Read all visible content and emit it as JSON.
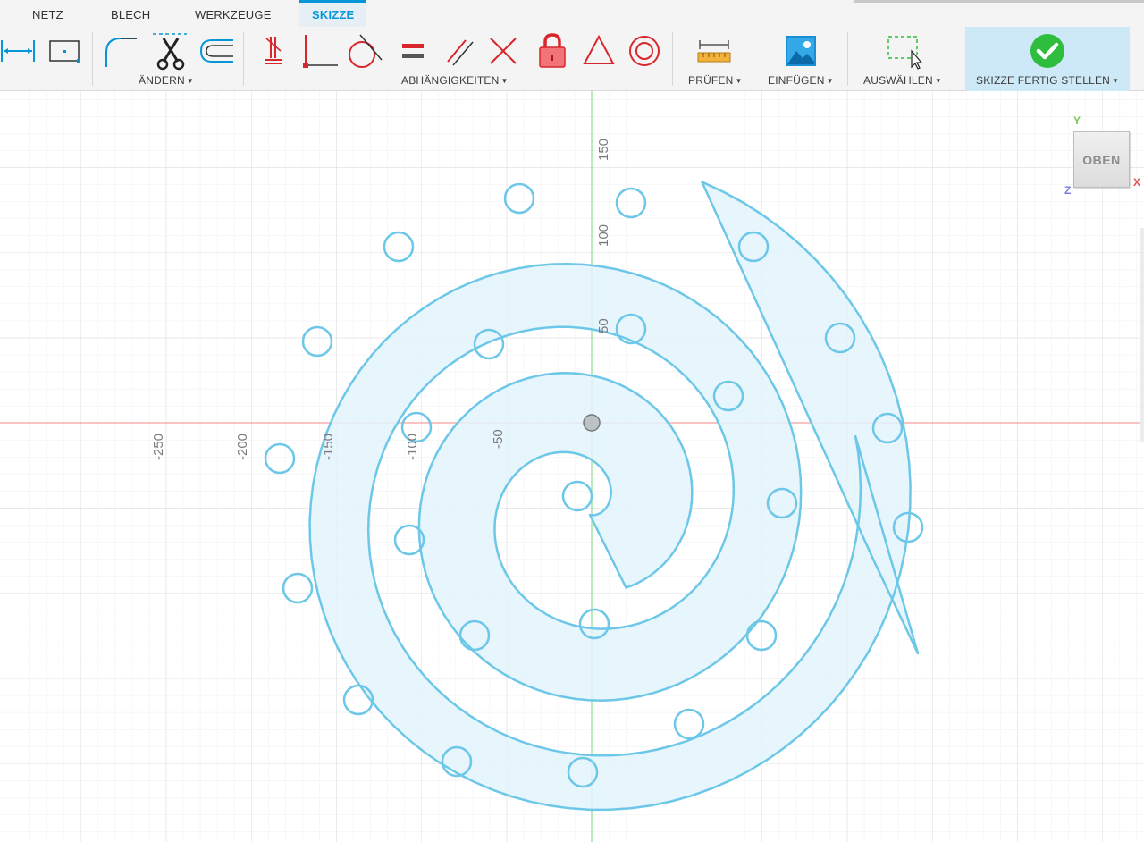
{
  "tabs": [
    {
      "label": "NETZ"
    },
    {
      "label": "BLECH"
    },
    {
      "label": "WERKZEUGE"
    },
    {
      "label": "SKIZZE"
    }
  ],
  "toolbar": {
    "groups": {
      "aendern": "ÄNDERN",
      "abhaengigkeiten": "ABHÄNGIGKEITEN",
      "pruefen": "PRÜFEN",
      "einfuegen": "EINFÜGEN",
      "auswaehlen": "AUSWÄHLEN",
      "finish": "SKIZZE FERTIG STELLEN"
    },
    "icons": [
      "dimension-icon",
      "center-rectangle-icon",
      "fillet-icon",
      "trim-icon",
      "offset-icon",
      "coincident-icon",
      "perpendicular-icon",
      "tangent-icon",
      "equal-icon",
      "parallel-icon",
      "collinear-icon",
      "fix-icon",
      "symmetry-icon",
      "concentric-icon",
      "measure-icon",
      "insert-image-icon",
      "select-icon",
      "checkmark-icon"
    ],
    "colors": {
      "accent": "#0696d7",
      "constraint": "#d8262c",
      "finish_bg": "#cde8f6",
      "check": "#2ebd3c"
    }
  },
  "canvas": {
    "ruler_labels": {
      "x": [
        "-250",
        "-200",
        "-150",
        "-100",
        "-50"
      ],
      "y": [
        "150",
        "100",
        "50"
      ]
    },
    "colors": {
      "sketch_line": "#6cc7e8",
      "sketch_fill": "#e3f3fb",
      "x_axis": "#f08a8a",
      "y_axis": "#7ad67a"
    }
  },
  "viewcube": {
    "face": "OBEN",
    "axes": {
      "y": "Y",
      "x": "X",
      "z": "Z"
    }
  }
}
